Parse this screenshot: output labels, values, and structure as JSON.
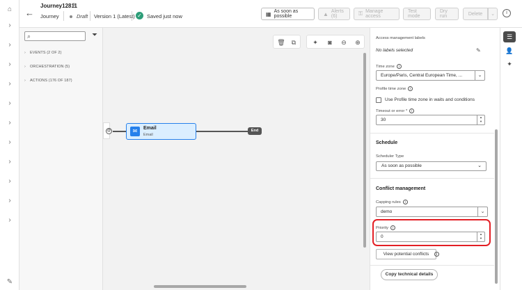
{
  "header": {
    "title": "Journey12811",
    "subtitle": "Journey",
    "status": "Draft",
    "version": "Version 1 (Latest)",
    "saved": "Saved just now",
    "buttons": {
      "schedule": "As soon as possible",
      "alerts": "Alerts (6)",
      "manage_access": "Manage access",
      "test_mode": "Test mode",
      "dry_run": "Dry run",
      "delete": "Delete"
    }
  },
  "left_panel": {
    "search_placeholder": "",
    "categories": [
      {
        "label": "EVENTS (2 OF 2)"
      },
      {
        "label": "ORCHESTRATION (5)"
      },
      {
        "label": "ACTIONS (176 OF 187)"
      }
    ]
  },
  "canvas": {
    "nodes": {
      "email_title": "Email",
      "email_subtitle": "Email",
      "end_label": "End"
    }
  },
  "properties": {
    "access_labels_title": "Access management labels",
    "access_labels_value": "No labels selected",
    "timezone_label": "Time zone",
    "timezone_value": "Europe/Paris, Central European Time, ...",
    "profile_tz_label": "Profile time zone",
    "profile_tz_checkbox": "Use Profile time zone in waits and conditions",
    "timeout_label": "Timeout or error",
    "timeout_value": "30",
    "schedule_title": "Schedule",
    "scheduler_type_label": "Scheduler Type",
    "scheduler_type_value": "As soon as possible",
    "conflict_title": "Conflict management",
    "capping_label": "Capping rules",
    "capping_value": "demo",
    "priority_label": "Priority",
    "priority_value": "0",
    "view_conflicts": "View potential conflicts",
    "copy_details": "Copy technical details"
  },
  "colors": {
    "accent": "#2680eb",
    "success": "#2d9d78",
    "highlight": "#e31e24"
  }
}
